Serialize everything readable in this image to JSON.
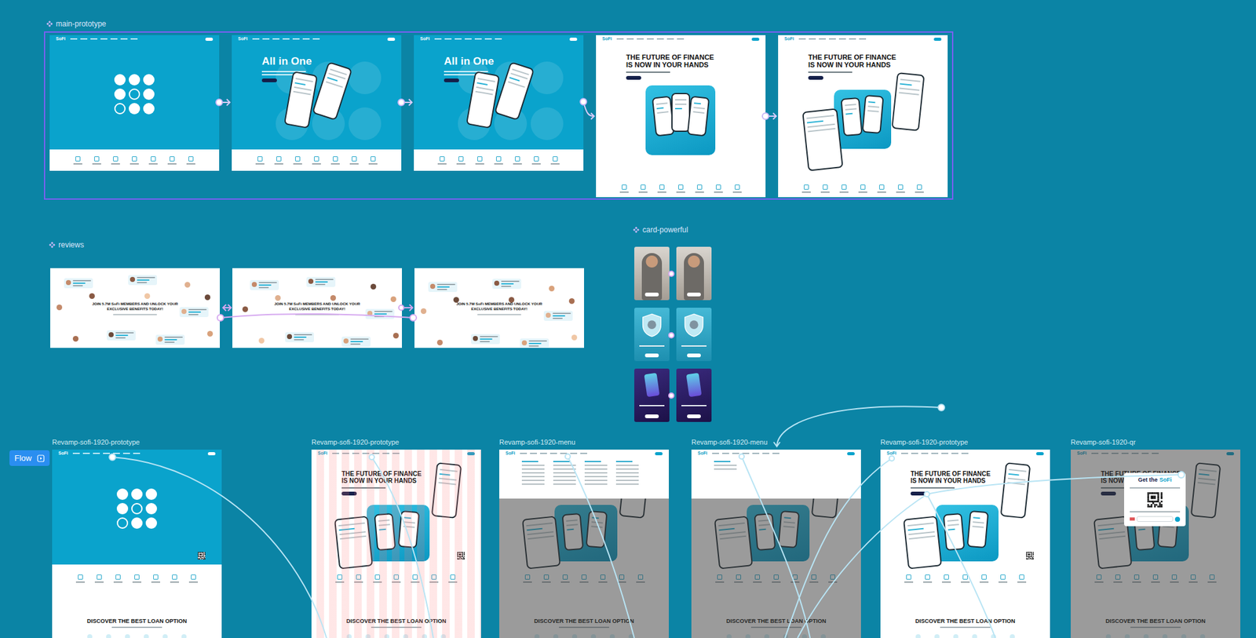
{
  "logo": "SoFi",
  "main_prototype": {
    "label": "main-prototype",
    "frames": [
      {
        "kind": "splash",
        "qr_badge": false
      },
      {
        "kind": "blue",
        "title": "All in One",
        "qr_badge": false
      },
      {
        "kind": "blue",
        "title": "All in One",
        "qr_badge": false
      },
      {
        "kind": "white",
        "title": "THE FUTURE OF FINANCE IS NOW IN YOUR HANDS",
        "phones": "stack",
        "qr_badge": false
      },
      {
        "kind": "white",
        "title": "THE FUTURE OF FINANCE IS NOW IN YOUR HANDS",
        "phones": "spread",
        "qr_badge": false
      }
    ]
  },
  "reviews": {
    "label": "reviews",
    "frames": [
      {
        "headline": "JOIN 5.7M SoFi MEMBERS AND UNLOCK YOUR EXCLUSIVE BENEFITS TODAY!"
      },
      {
        "headline": "JOIN 5.7M SoFi MEMBERS AND UNLOCK YOUR EXCLUSIVE BENEFITS TODAY!"
      },
      {
        "headline": "JOIN 5.7M SoFi MEMBERS AND UNLOCK YOUR EXCLUSIVE BENEFITS TODAY!"
      }
    ]
  },
  "card_powerful": {
    "label": "card-powerful",
    "cards": [
      {
        "kind": "photo"
      },
      {
        "kind": "photo"
      },
      {
        "kind": "shield"
      },
      {
        "kind": "shield"
      },
      {
        "kind": "plus"
      },
      {
        "kind": "plus"
      }
    ]
  },
  "flow": {
    "button": "Flow",
    "frames": [
      {
        "label": "Revamp-sofi-1920-prototype",
        "kind": "splash",
        "overlay": "none",
        "grid": false,
        "qr_badge": true,
        "section": "DISCOVER THE BEST LOAN OPTION"
      },
      {
        "label": "Revamp-sofi-1920-prototype",
        "kind": "white",
        "title": "THE FUTURE OF FINANCE IS NOW IN YOUR HANDS",
        "phones": "spread",
        "overlay": "none",
        "grid": true,
        "qr_badge": true,
        "section": "DISCOVER THE BEST LOAN OPTION"
      },
      {
        "label": "Revamp-sofi-1920-menu",
        "kind": "white",
        "phones": "spread",
        "overlay": "menu",
        "grid": false,
        "qr_badge": false,
        "section": "DISCOVER THE BEST LOAN OPTION"
      },
      {
        "label": "Revamp-sofi-1920-menu",
        "kind": "white",
        "phones": "spread",
        "overlay": "menu-short",
        "grid": false,
        "qr_badge": false,
        "section": "DISCOVER THE BEST LOAN OPTION"
      },
      {
        "label": "Revamp-sofi-1920-prototype",
        "kind": "white",
        "title": "THE FUTURE OF FINANCE IS NOW IN YOUR HANDS",
        "phones": "spread",
        "overlay": "none",
        "grid": false,
        "qr_badge": true,
        "section": "DISCOVER THE BEST LOAN OPTION"
      },
      {
        "label": "Revamp-sofi-1920-qr",
        "kind": "white",
        "title": "THE FUTURE OF FINANCE IS NOW IN YOUR HANDS",
        "phones": "spread",
        "overlay": "qr",
        "grid": false,
        "qr_badge": false,
        "section": "DISCOVER THE BEST LOAN OPTION",
        "popup": {
          "title": "Get the",
          "logo": "SoFi"
        }
      }
    ]
  }
}
